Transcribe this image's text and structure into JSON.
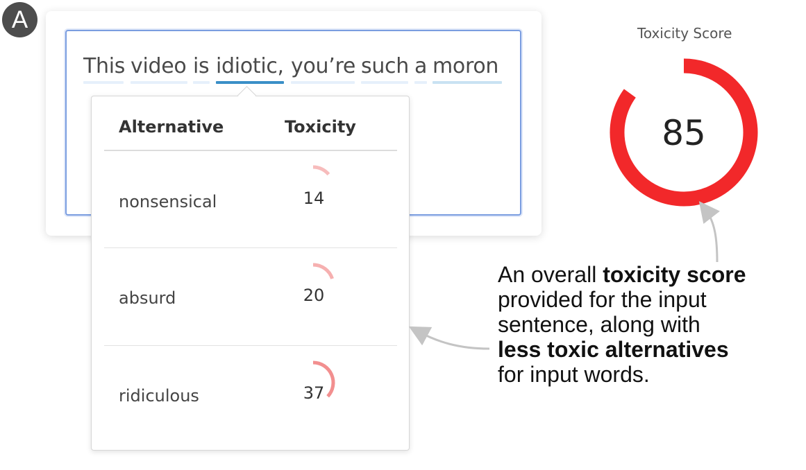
{
  "panel_label": "A",
  "input": {
    "words": [
      "This",
      "video",
      "is",
      "idiotic,",
      "you’re",
      "such",
      "a",
      "moron"
    ]
  },
  "popup": {
    "headers": {
      "alternative": "Alternative",
      "toxicity": "Toxicity"
    },
    "rows": [
      {
        "word": "nonsensical",
        "toxicity": "14",
        "value": 14
      },
      {
        "word": "absurd",
        "toxicity": "20",
        "value": 20
      },
      {
        "word": "ridiculous",
        "toxicity": "37",
        "value": 37
      }
    ]
  },
  "toxicity": {
    "label": "Toxicity Score",
    "score": "85",
    "value": 85,
    "color": "#f2282a"
  },
  "callout": {
    "line1_pre": "An overall ",
    "line1_bold": "toxicity score",
    "line2": "provided for the input",
    "line3": "sentence, along with",
    "line4_bold": "less toxic alternatives",
    "line5": "for input words."
  },
  "colors": {
    "underline_light": "#e6f0fb",
    "underline_selected": "#3a8fc7",
    "underline_toxic": "#c9e2f2",
    "alt_gauge": "#f28b8b",
    "arrow": "#c4c4c4"
  }
}
